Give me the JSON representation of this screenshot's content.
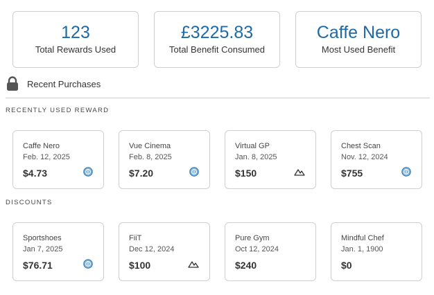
{
  "stats": [
    {
      "value": "123",
      "label": "Total Rewards Used"
    },
    {
      "value": "£3225.83",
      "label": "Total Benefit Consumed"
    },
    {
      "value": "Caffe Nero",
      "label": "Most Used Benefit"
    }
  ],
  "recent_purchases": {
    "label": "Recent Purchases",
    "icon": "lock-icon"
  },
  "sections": {
    "recent_heading": "Recently used reward",
    "discounts_heading": "Discounts"
  },
  "recent_rewards": [
    {
      "name": "Caffe Nero",
      "date": "Feb. 12, 2025",
      "amount": "$4.73",
      "icon": "coin-icon"
    },
    {
      "name": "Vue Cinema",
      "date": "Feb. 8, 2025",
      "amount": "$7.20",
      "icon": "coin-icon"
    },
    {
      "name": "Virtual GP",
      "date": "Jan. 8, 2025",
      "amount": "$150",
      "icon": "mountain-icon"
    },
    {
      "name": "Chest Scan",
      "date": "Nov. 12, 2024",
      "amount": "$755",
      "icon": "coin-icon"
    }
  ],
  "discounts": [
    {
      "name": "Sportshoes",
      "date": "Jan 7, 2025",
      "amount": "$76.71",
      "icon": "coin-icon"
    },
    {
      "name": "FiiT",
      "date": "Dec 12, 2024",
      "amount": "$100",
      "icon": "mountain-icon"
    },
    {
      "name": "Pure Gym",
      "date": "Oct 12, 2024",
      "amount": "$240",
      "icon": ""
    },
    {
      "name": "Mindful Chef",
      "date": "Jan. 1, 1900",
      "amount": "$0",
      "icon": ""
    }
  ],
  "colors": {
    "accent": "#1f6aa5",
    "border": "#cfcfcf",
    "coin_fill": "#7fb3d9",
    "coin_stroke": "#3b7fb6"
  }
}
